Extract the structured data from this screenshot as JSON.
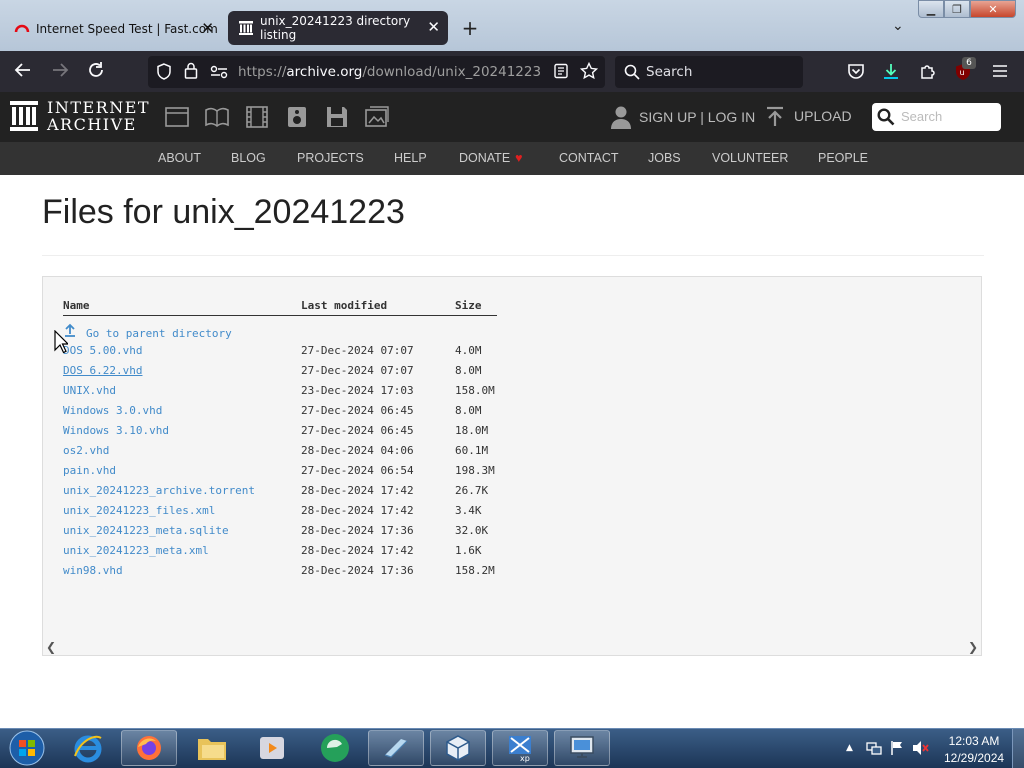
{
  "browser": {
    "tabs": [
      {
        "title": "Internet Speed Test | Fast.com",
        "icon": "fast-com-icon",
        "active": false
      },
      {
        "title": "unix_20241223 directory listing",
        "icon": "archive-icon",
        "active": true
      }
    ],
    "url_prefix": "https://",
    "url_host": "archive.org",
    "url_path": "/download/unix_20241223",
    "search_placeholder": "Search",
    "extension_badge": "6"
  },
  "ia_header": {
    "logo_line1": "INTERNET",
    "logo_line2": "ARCHIVE",
    "signup": "SIGN UP | LOG IN",
    "upload": "UPLOAD",
    "search_placeholder": "Search",
    "nav": [
      "ABOUT",
      "BLOG",
      "PROJECTS",
      "HELP",
      "DONATE",
      "CONTACT",
      "JOBS",
      "VOLUNTEER",
      "PEOPLE"
    ]
  },
  "page": {
    "title": "Files for unix_20241223",
    "columns": {
      "name": "Name",
      "modified": "Last modified",
      "size": "Size"
    },
    "parent": "Go to parent directory",
    "files": [
      {
        "name": "DOS 5.00.vhd",
        "modified": "27-Dec-2024 07:07",
        "size": "4.0M"
      },
      {
        "name": "DOS 6.22.vhd",
        "modified": "27-Dec-2024 07:07",
        "size": "8.0M"
      },
      {
        "name": "UNIX.vhd",
        "modified": "23-Dec-2024 17:03",
        "size": "158.0M"
      },
      {
        "name": "Windows 3.0.vhd",
        "modified": "27-Dec-2024 06:45",
        "size": "8.0M"
      },
      {
        "name": "Windows 3.10.vhd",
        "modified": "27-Dec-2024 06:45",
        "size": "18.0M"
      },
      {
        "name": "os2.vhd",
        "modified": "28-Dec-2024 04:06",
        "size": "60.1M"
      },
      {
        "name": "pain.vhd",
        "modified": "27-Dec-2024 06:54",
        "size": "198.3M"
      },
      {
        "name": "unix_20241223_archive.torrent",
        "modified": "28-Dec-2024 17:42",
        "size": "26.7K"
      },
      {
        "name": "unix_20241223_files.xml",
        "modified": "28-Dec-2024 17:42",
        "size": "3.4K"
      },
      {
        "name": "unix_20241223_meta.sqlite",
        "modified": "28-Dec-2024 17:36",
        "size": "32.0K"
      },
      {
        "name": "unix_20241223_meta.xml",
        "modified": "28-Dec-2024 17:42",
        "size": "1.6K"
      },
      {
        "name": "win98.vhd",
        "modified": "28-Dec-2024 17:36",
        "size": "158.2M"
      }
    ]
  },
  "taskbar": {
    "time": "12:03 AM",
    "date": "12/29/2024"
  },
  "colors": {
    "link": "#428bca",
    "browser_dark": "#2b2a33",
    "ia_header": "#222222",
    "ia_nav": "#333333",
    "donate_heart": "#e02020"
  }
}
